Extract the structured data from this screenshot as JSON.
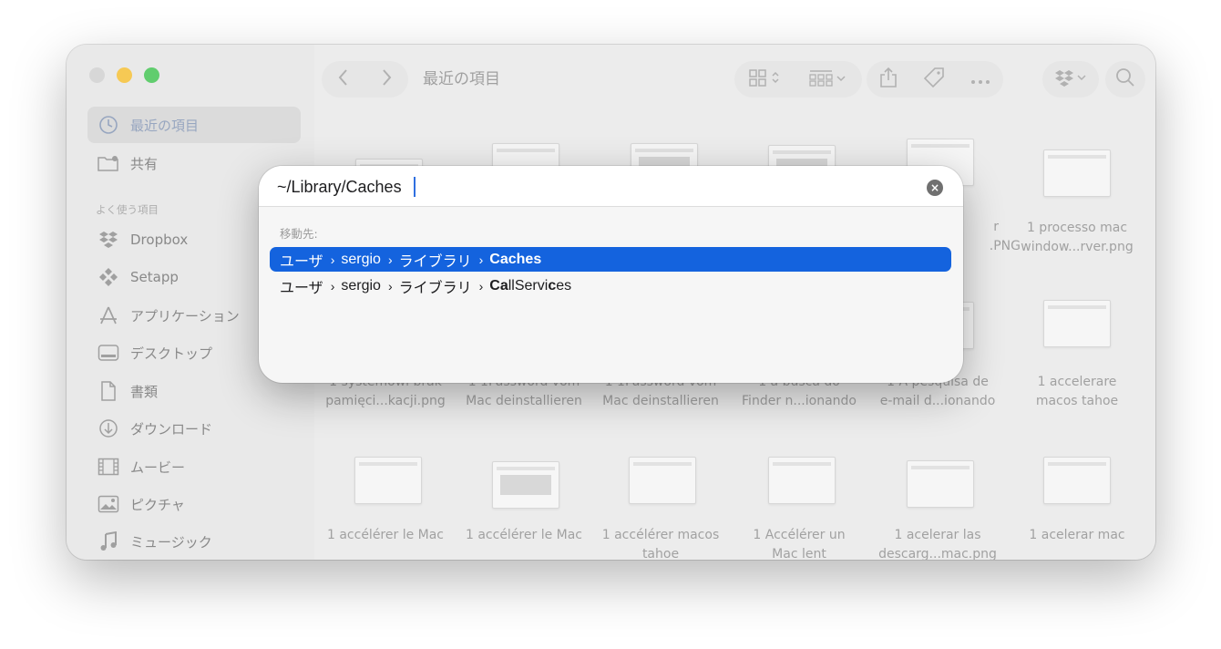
{
  "window": {
    "toolbar": {
      "back_icon": "chevron-left-icon",
      "forward_icon": "chevron-right-icon",
      "title": "最近の項目"
    },
    "sidebar": {
      "items": [
        {
          "label": "最近の項目",
          "icon": "clock-icon"
        },
        {
          "label": "共有",
          "icon": "shared-folder-icon"
        }
      ],
      "section_title": "よく使う項目",
      "favorites": [
        {
          "label": "Dropbox",
          "icon": "dropbox-icon"
        },
        {
          "label": "Setapp",
          "icon": "setapp-icon"
        },
        {
          "label": "アプリケーション",
          "icon": "applications-icon"
        },
        {
          "label": "デスクトップ",
          "icon": "desktop-icon"
        },
        {
          "label": "書類",
          "icon": "document-icon"
        },
        {
          "label": "ダウンロード",
          "icon": "download-icon"
        },
        {
          "label": "ムービー",
          "icon": "film-icon"
        },
        {
          "label": "ピクチャ",
          "icon": "photo-icon"
        },
        {
          "label": "ミュージック",
          "icon": "music-icon"
        }
      ]
    },
    "files": [
      {
        "line1": "r",
        "line2": ".PNG"
      },
      {
        "line1": "1  processo mac",
        "line2": "window...rver.png"
      },
      {
        "line1": "1  systemowi brak",
        "line2": "pamięci...kacji.png"
      },
      {
        "line1": "1 1Password vom",
        "line2": "Mac deinstallieren"
      },
      {
        "line1": "1 1Password vom",
        "line2": "Mac deinstallieren"
      },
      {
        "line1": "1 a busca do",
        "line2": "Finder n...ionando"
      },
      {
        "line1": "1 A pesquisa de",
        "line2": "e-mail d...ionando"
      },
      {
        "line1": "1 accelerare",
        "line2": "macos tahoe"
      },
      {
        "line1": "1 accélérer le Mac",
        "line2": ""
      },
      {
        "line1": "1 accélérer le Mac",
        "line2": ""
      },
      {
        "line1": "1 accélérer macos",
        "line2": "tahoe"
      },
      {
        "line1": "1 Accélérer un",
        "line2": "Mac lent"
      },
      {
        "line1": "1 acelerar las",
        "line2": "descarg...mac.png"
      },
      {
        "line1": "1 acelerar mac",
        "line2": ""
      }
    ]
  },
  "dialog": {
    "path_value": "~/Library/Caches",
    "clear_icon": "clear-icon",
    "heading": "移動先:",
    "suggestions": [
      {
        "parts": [
          "ユーザ",
          "sergio",
          "ライブラリ"
        ],
        "last_bold": "Caches",
        "last_rest": "",
        "selected": true
      },
      {
        "parts": [
          "ユーザ",
          "sergio",
          "ライブラリ"
        ],
        "last_bold": "Ca",
        "last_mid": "llServi",
        "last_bold2": "c",
        "last_rest": "es",
        "selected": false
      }
    ]
  }
}
